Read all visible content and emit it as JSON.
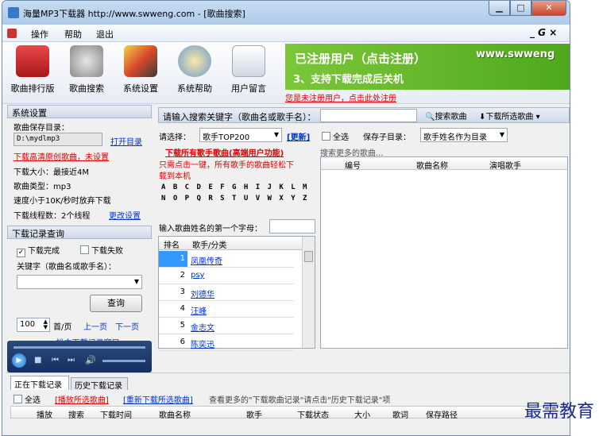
{
  "window": {
    "title": "海量MP3下载器 http://www.swweng.com - [歌曲搜索]"
  },
  "menu": {
    "items": [
      "操作",
      "帮助",
      "退出"
    ],
    "right_controls": "_ 𝙂 ×"
  },
  "toolbar": {
    "buttons": [
      {
        "label": "歌曲排行版",
        "icon": "ranking-icon"
      },
      {
        "label": "歌曲搜索",
        "icon": "music-search-icon"
      },
      {
        "label": "系统设置",
        "icon": "settings-tools-icon"
      },
      {
        "label": "系统帮助",
        "icon": "help-robot-icon"
      },
      {
        "label": "用户留言",
        "icon": "message-note-icon"
      }
    ]
  },
  "banner": {
    "line1": "已注册用户（点击注册）",
    "line2": "3、支持下载完成后关机",
    "url": "www.swweng",
    "reg_link": "您是未注册用户，点击此处注册"
  },
  "settings": {
    "header": "系统设置",
    "save_dir_label": "歌曲保存目录：",
    "save_dir_value": "D:\\mydlmp3",
    "open_dir": "打开目录",
    "hq_link": "下载高清原创歌曲，未设置",
    "size_label": "下载大小：最接近4M",
    "type_label": "歌曲类型：mp3",
    "speed_label": "速度小于10K/秒时放弃下载",
    "threads_label": "下载线程数：2个线程",
    "change_settings": "更改设置"
  },
  "query": {
    "header": "下载记录查询",
    "done_label": "下载完成",
    "fail_label": "下载失败",
    "keyword_label": "关键字（歌曲名或歌手名）：",
    "query_button": "查询",
    "page_size": "100",
    "first_page": "首/页",
    "prev_page": "上一页",
    "next_page": "下一页",
    "partial_link": "...松本下载记录窗口..."
  },
  "search": {
    "prompt": "请输入搜索关键字（歌曲名或歌手名）：",
    "search_button": "搜索歌曲",
    "download_selected": "下载所选歌曲",
    "select_label": "请选择：",
    "select_value": "歌手TOP200",
    "refresh": "[更新]",
    "select_all": "全选",
    "subdir_label": "保存子目录：",
    "subdir_value": "歌手姓名作为目录",
    "download_all_title": "下载所有歌手歌曲(高端用户功能)",
    "download_all_desc1": "只需点击一键，所有歌手的歌曲轻松下",
    "download_all_desc2": "载到本机",
    "alphabet_row1": "A B C D E F G H I J K L M",
    "alphabet_row2": "N O P Q R S T U V W X Y Z",
    "first_letter_label": "输入歌曲姓名的第一个字母：",
    "more_songs": "搜索更多的歌曲..."
  },
  "artist_list": {
    "columns": [
      "排名",
      "歌手/分类"
    ],
    "rows": [
      {
        "rank": "1",
        "name": "凤凰传奇"
      },
      {
        "rank": "2",
        "name": "psy"
      },
      {
        "rank": "3",
        "name": "刘德华"
      },
      {
        "rank": "4",
        "name": "汪峰"
      },
      {
        "rank": "5",
        "name": "金志文"
      },
      {
        "rank": "6",
        "name": "陈奕迅"
      }
    ]
  },
  "results": {
    "columns": [
      "编号",
      "歌曲名称",
      "演唱歌手"
    ]
  },
  "downloads": {
    "tabs": [
      "正在下载记录",
      "历史下载记录"
    ],
    "select_all": "全选",
    "play_selected": "[播放所选歌曲]",
    "redownload_selected": "[重新下载所选歌曲]",
    "hint": "查看更多的\"下载歌曲记录\"请点击\"历史下载记录\"项",
    "columns": [
      "播放",
      "搜索",
      "下载时间",
      "歌曲名称",
      "歌手",
      "下载状态",
      "大小",
      "歌词",
      "保存路径"
    ]
  },
  "watermark": "最需教育"
}
